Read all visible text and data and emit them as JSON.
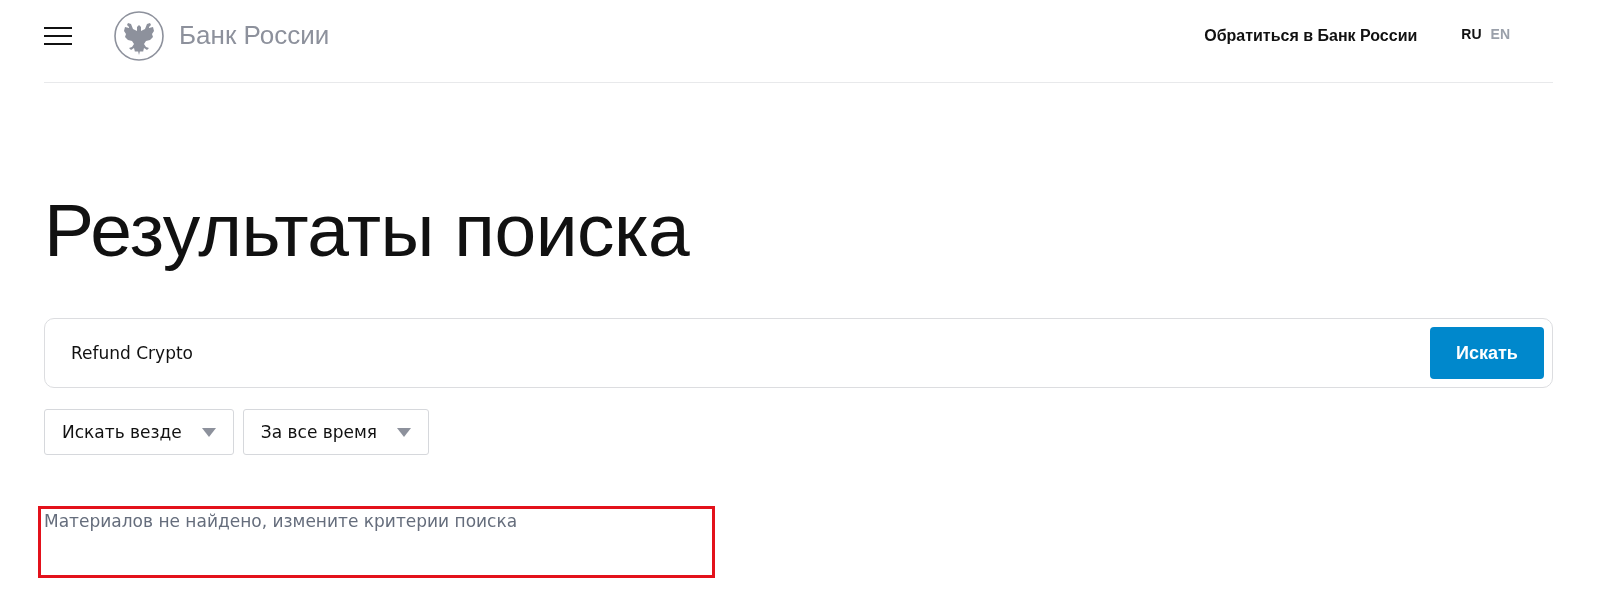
{
  "header": {
    "logo_text": "Банк России",
    "contact_link": "Обратиться в Банк России",
    "languages": [
      {
        "label": "RU",
        "selected": true
      },
      {
        "label": "EN",
        "selected": false
      }
    ]
  },
  "page_title": "Результаты поиска",
  "search": {
    "value": "Refund Crypto",
    "button": "Искать"
  },
  "filters": [
    {
      "label": "Искать везде"
    },
    {
      "label": "За все время"
    }
  ],
  "results": {
    "message": "Материалов не найдено, измените критерии поиска",
    "highlighted": true
  }
}
